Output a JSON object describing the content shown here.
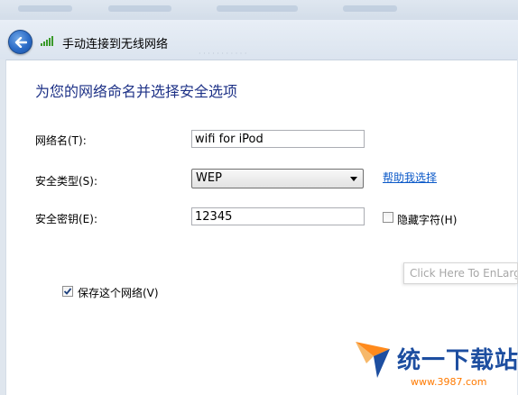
{
  "window": {
    "title": "手动连接到无线网络"
  },
  "page": {
    "heading": "为您的网络命名并选择安全选项"
  },
  "form": {
    "network_name": {
      "label": "网络名(T):",
      "value": "wifi for iPod"
    },
    "security_type": {
      "label": "安全类型(S):",
      "value": "WEP"
    },
    "help_link": "帮助我选择",
    "security_key": {
      "label": "安全密钥(E):",
      "value": "12345"
    },
    "hide_characters": {
      "label": "隐藏字符(H)",
      "checked": false
    },
    "save_network": {
      "label": "保存这个网络(V)",
      "checked": true
    }
  },
  "overlay": {
    "enlarge_label": "Click Here To EnLarge"
  },
  "watermark": {
    "brand": "统一下载站",
    "url": "www.3987.com"
  },
  "colors": {
    "heading": "#1e3287",
    "link": "#0b59c8",
    "watermark_blue": "#1d4ea0",
    "watermark_orange": "#ff7a00"
  },
  "icons": {
    "back": "back-arrow-icon",
    "signal": "wireless-signal-icon",
    "dropdown": "chevron-down-icon",
    "check": "check-icon"
  }
}
